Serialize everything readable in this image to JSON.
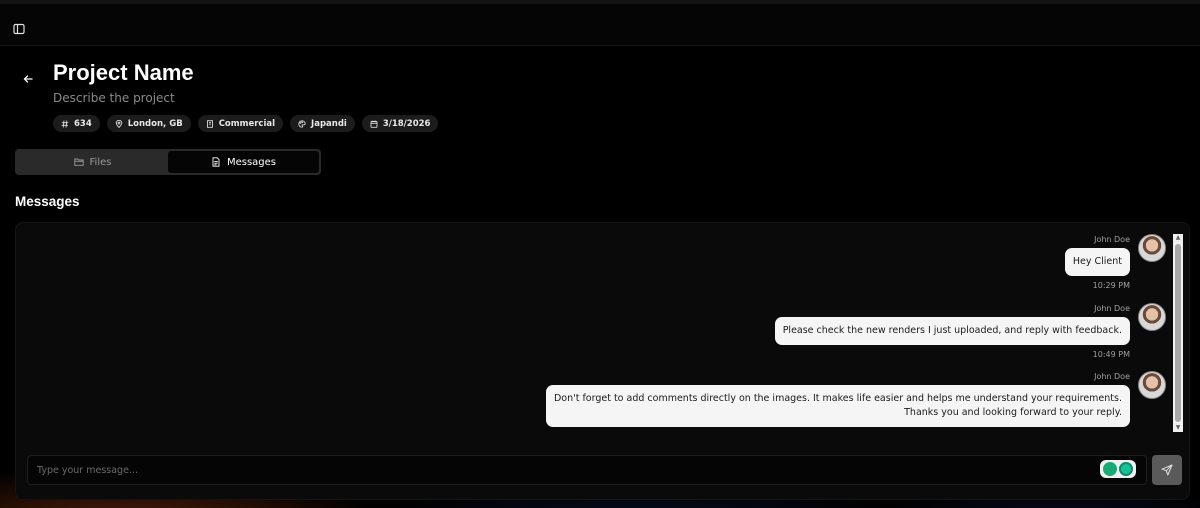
{
  "project": {
    "title": "Project Name",
    "description": "Describe the project",
    "badges": [
      {
        "icon": "hash-icon",
        "label": "634"
      },
      {
        "icon": "location-pin-icon",
        "label": "London, GB"
      },
      {
        "icon": "building-icon",
        "label": "Commercial"
      },
      {
        "icon": "palette-icon",
        "label": "Japandi"
      },
      {
        "icon": "calendar-icon",
        "label": "3/18/2026"
      }
    ]
  },
  "tabs": [
    {
      "label": "Files",
      "icon": "folder-icon",
      "active": false
    },
    {
      "label": "Messages",
      "icon": "document-icon",
      "active": true
    }
  ],
  "messages_section": {
    "title": "Messages",
    "items": [
      {
        "sender": "John Doe",
        "text": "Hey Client",
        "time": "10:29 PM"
      },
      {
        "sender": "John Doe",
        "text": "Please check the new renders I just uploaded, and reply with feedback.",
        "time": "10:49 PM"
      },
      {
        "sender": "John Doe",
        "text_lines": [
          "Don't forget to add comments directly on the images. It makes life easier and helps me understand your requirements.",
          "Thanks you and looking forward to your reply."
        ]
      }
    ]
  },
  "composer": {
    "placeholder": "Type your message...",
    "send_icon": "send-icon"
  },
  "colors": {
    "background": "#000000",
    "bubble": "#f5f5f5",
    "send_button": "#5a5a5a"
  }
}
